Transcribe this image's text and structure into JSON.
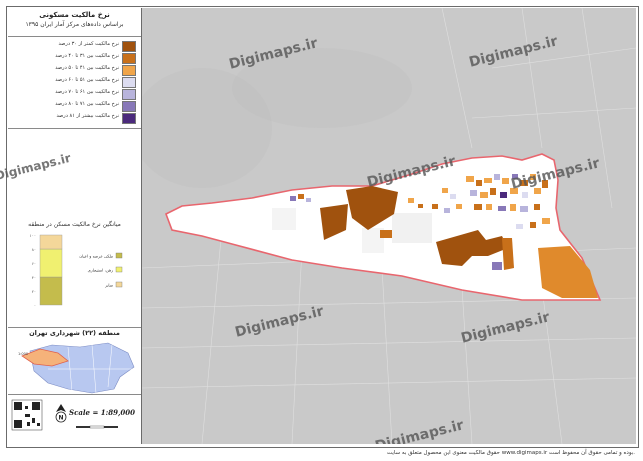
{
  "map": {
    "title": "نرخ مالکیت مسکونی",
    "subtitle": "براساس داده‌های مرکز آمار ایران ۱۳۹۵",
    "legend": [
      {
        "label": "نرخ مالکیت کمتر از ۳۰ درصد",
        "color": "#a0520e"
      },
      {
        "label": "نرخ مالکیت بین ۳۱ تا ۴۰ درصد",
        "color": "#c8701a"
      },
      {
        "label": "نرخ مالکیت بین ۴۱ تا ۵۰ درصد",
        "color": "#f0a54a"
      },
      {
        "label": "نرخ مالکیت بین ۵۱ تا ۶۰ درصد",
        "color": "#dcdcf0"
      },
      {
        "label": "نرخ مالکیت بین ۶۱ تا ۷۰ درصد",
        "color": "#b8b4dc"
      },
      {
        "label": "نرخ مالکیت بین ۷۱ تا ۸۰ درصد",
        "color": "#8878b8"
      },
      {
        "label": "نرخ مالکیت بیشتر از ۸۱ درصد",
        "color": "#4b2a7c"
      }
    ],
    "district_title": "منطقه (۲۲) شهرداری تهران",
    "scale": "Scale = 1:89,000"
  },
  "chart_data": {
    "type": "bar",
    "title": "میانگین نرخ مالکیت مسکن در منطقه",
    "categories": [
      "منطقه ۲۲"
    ],
    "ylim": [
      0,
      100
    ],
    "yticks": [
      "۱۰۰",
      "۸۰",
      "۶۰",
      "۴۰",
      "۲۰",
      "۰"
    ],
    "series": [
      {
        "name": "ملکی عرصه و اعیان",
        "values": [
          40
        ],
        "color": "#c4bc4c"
      },
      {
        "name": "رهن، استیجاری",
        "values": [
          40
        ],
        "color": "#f0f070"
      },
      {
        "name": "سایر",
        "values": [
          20
        ],
        "color": "#f4d79a"
      }
    ]
  },
  "watermark": "Digimaps.ir",
  "footer": "حقوق مالکیت معنوی این محصول متعلق به سایت www.digimaps.ir بوده و تمامی حقوق آن محفوظ است."
}
